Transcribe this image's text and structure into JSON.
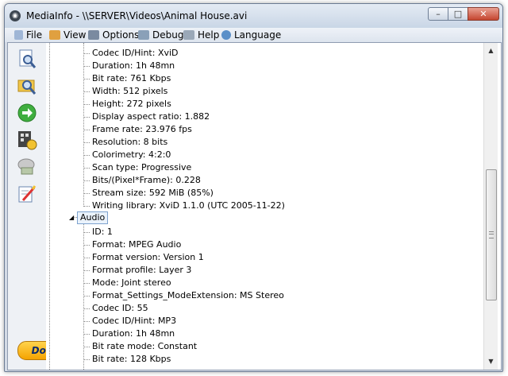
{
  "window": {
    "title": "MediaInfo - \\\\SERVER\\Videos\\Animal House.avi",
    "controls": {
      "minimize": "–",
      "maximize": "□",
      "close": "✕"
    }
  },
  "menu": {
    "items": [
      {
        "label": "File",
        "icon": "file-icon"
      },
      {
        "label": "View",
        "icon": "view-icon"
      },
      {
        "label": "Options",
        "icon": "options-icon"
      },
      {
        "label": "Debug",
        "icon": "debug-icon"
      },
      {
        "label": "Help",
        "icon": "help-icon"
      },
      {
        "label": "Language",
        "icon": "language-icon"
      }
    ]
  },
  "toolbar": {
    "buttons": [
      {
        "icon": "open-file-icon"
      },
      {
        "icon": "open-folder-icon"
      },
      {
        "icon": "go-arrow-icon"
      },
      {
        "icon": "export-icon"
      },
      {
        "icon": "preferences-icon"
      },
      {
        "icon": "edit-icon"
      }
    ],
    "donate_label": "Donate"
  },
  "tree": {
    "video_rows": [
      "Codec ID/Hint: XviD",
      "Duration: 1h 48mn",
      "Bit rate: 761 Kbps",
      "Width: 512 pixels",
      "Height: 272 pixels",
      "Display aspect ratio: 1.882",
      "Frame rate: 23.976 fps",
      "Resolution: 8 bits",
      "Colorimetry: 4:2:0",
      "Scan type: Progressive",
      "Bits/(Pixel*Frame): 0.228",
      "Stream size: 592 MiB (85%)",
      "Writing library: XviD 1.1.0 (UTC 2005-11-22)"
    ],
    "audio_node": "Audio",
    "audio_rows": [
      "ID: 1",
      "Format: MPEG Audio",
      "Format version: Version 1",
      "Format profile: Layer 3",
      "Mode: Joint stereo",
      "Format_Settings_ModeExtension: MS Stereo",
      "Codec ID: 55",
      "Codec ID/Hint: MP3",
      "Duration: 1h 48mn",
      "Bit rate mode: Constant",
      "Bit rate: 128 Kbps"
    ]
  },
  "scrollbar": {
    "up": "▲",
    "down": "▼"
  },
  "colors": {
    "donate_bg": "#f5a300",
    "title_bar": "#c9d6e6"
  }
}
